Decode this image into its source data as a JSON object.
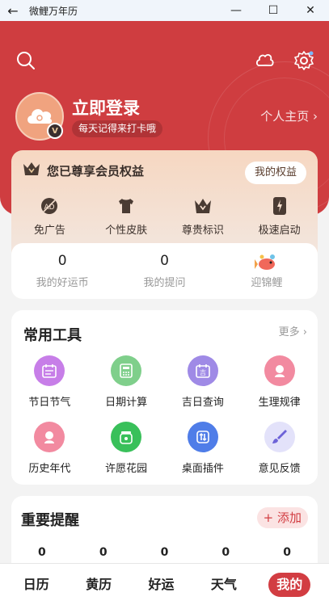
{
  "window": {
    "title": "微鲤万年历",
    "back_glyph": "←",
    "minimize_glyph": "—",
    "maximize_glyph": "☐",
    "close_glyph": "✕"
  },
  "header": {
    "login_title": "立即登录",
    "login_subtitle": "每天记得来打卡哦",
    "homepage_link": "个人主页 ›",
    "vip_badge": "V"
  },
  "vip": {
    "title": "您已尊享会员权益",
    "rights_button": "我的权益",
    "perks": [
      {
        "label": "免广告",
        "icon": "no-ad-icon"
      },
      {
        "label": "个性皮肤",
        "icon": "shirt-icon"
      },
      {
        "label": "尊贵标识",
        "icon": "crown-icon"
      },
      {
        "label": "极速启动",
        "icon": "fast-start-icon"
      }
    ]
  },
  "stats": [
    {
      "value": "0",
      "label": "我的好运币"
    },
    {
      "value": "0",
      "label": "我的提问"
    },
    {
      "value": "",
      "label": "迎锦鲤",
      "icon": "koi-icon"
    }
  ],
  "tools": {
    "title": "常用工具",
    "more": "更多 ›",
    "items": [
      {
        "label": "节日节气",
        "icon": "calendar-icon",
        "color": "#c77ee8"
      },
      {
        "label": "日期计算",
        "icon": "calculator-icon",
        "color": "#7fcf8b"
      },
      {
        "label": "吉日查询",
        "icon": "lucky-day-icon",
        "color": "#9f8ae6"
      },
      {
        "label": "生理规律",
        "icon": "cycle-icon",
        "color": "#f28aa0"
      },
      {
        "label": "历史年代",
        "icon": "history-icon",
        "color": "#f28aa0"
      },
      {
        "label": "许愿花园",
        "icon": "wish-jar-icon",
        "color": "#39c05a"
      },
      {
        "label": "桌面插件",
        "icon": "widget-icon",
        "color": "#4f7de8"
      },
      {
        "label": "意见反馈",
        "icon": "brush-icon",
        "color": "#e3e2fa"
      }
    ]
  },
  "reminder": {
    "title": "重要提醒",
    "add_button": "+ 添加",
    "counts": [
      "0",
      "0",
      "0",
      "0",
      "0"
    ]
  },
  "nav": [
    {
      "label": "日历",
      "active": false
    },
    {
      "label": "黄历",
      "active": false
    },
    {
      "label": "好运",
      "active": false
    },
    {
      "label": "天气",
      "active": false
    },
    {
      "label": "我的",
      "active": true
    }
  ],
  "colors": {
    "brand_red": "#cf3d40",
    "accent_red": "#d23d42"
  }
}
